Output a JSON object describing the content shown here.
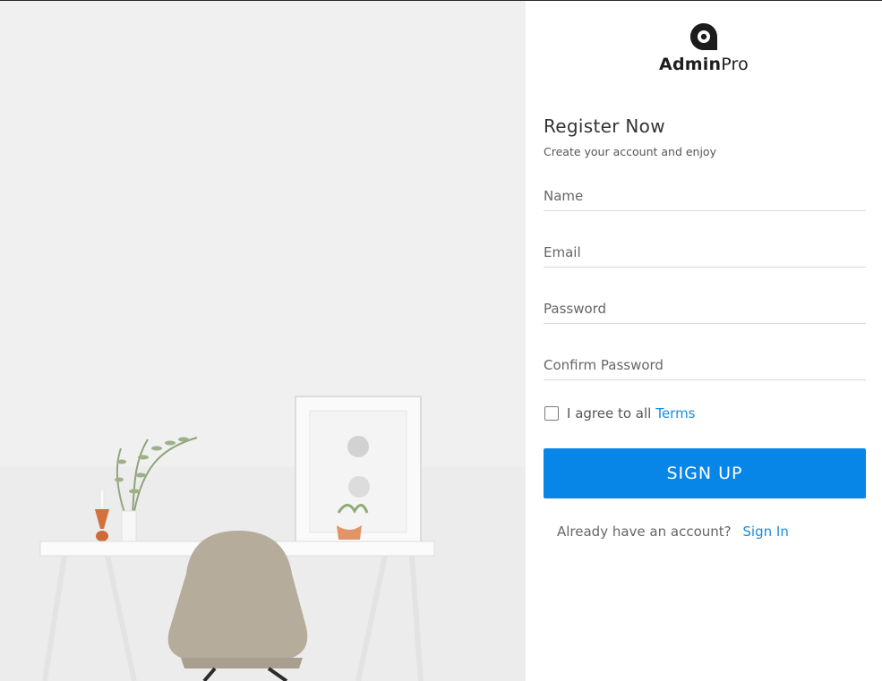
{
  "brand": {
    "name_bold": "Admin",
    "name_light": "Pro"
  },
  "form": {
    "title": "Register Now",
    "subtitle": "Create your account and enjoy",
    "fields": {
      "name": {
        "placeholder": "Name",
        "value": ""
      },
      "email": {
        "placeholder": "Email",
        "value": ""
      },
      "password": {
        "placeholder": "Password",
        "value": ""
      },
      "confirm_password": {
        "placeholder": "Confirm Password",
        "value": ""
      }
    },
    "terms": {
      "checked": false,
      "text": "I agree to all",
      "link": "Terms"
    },
    "submit_label": "SIGN UP",
    "signin": {
      "text": "Already have an account?",
      "link": "Sign In"
    }
  },
  "colors": {
    "accent": "#0786e8",
    "link": "#1a8cde",
    "hero_background": "#efefef"
  }
}
